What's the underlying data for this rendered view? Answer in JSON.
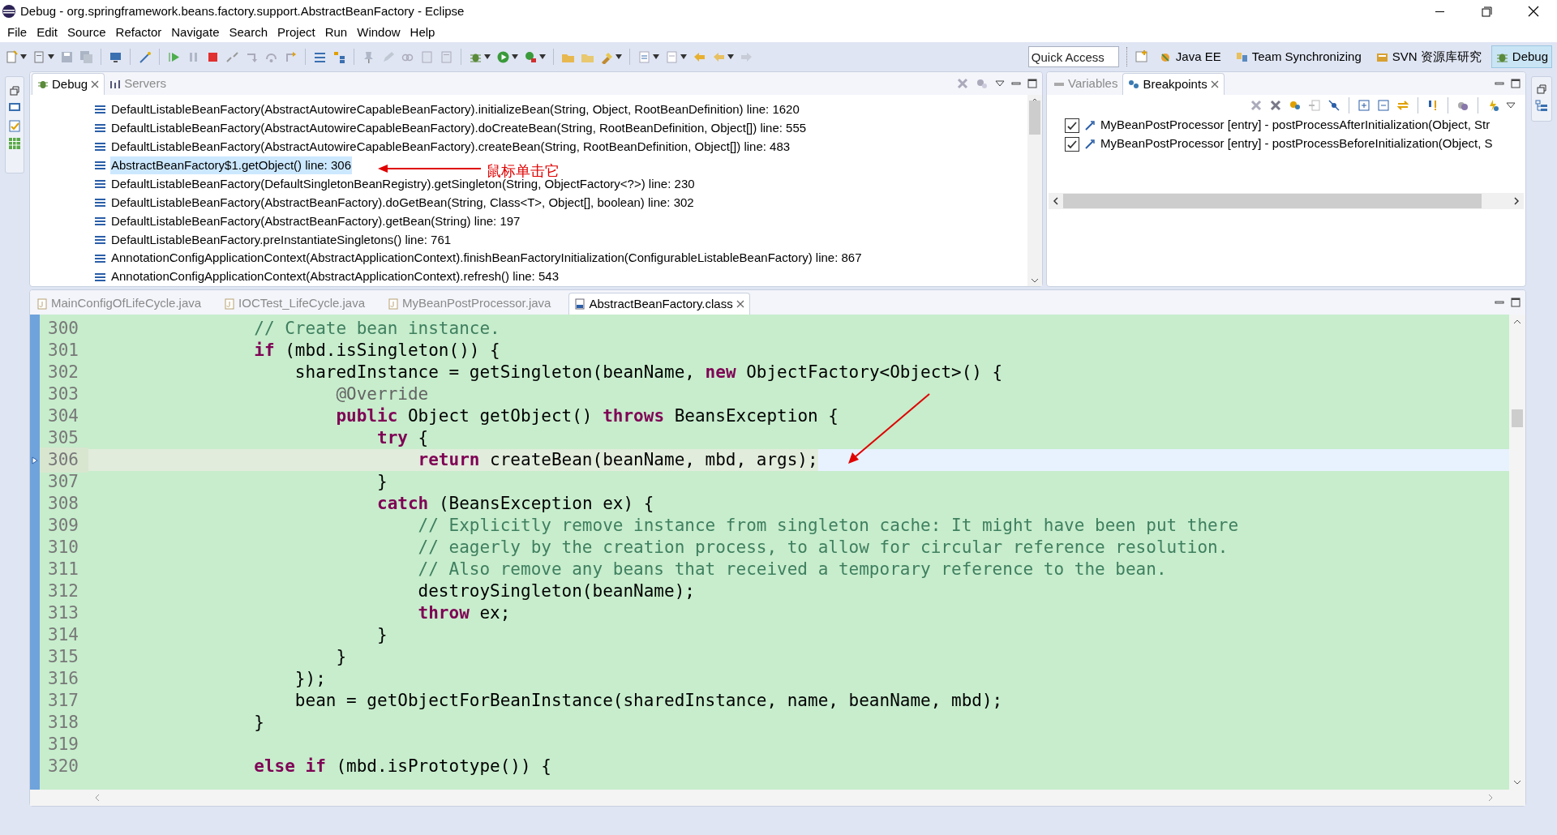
{
  "window": {
    "title": "Debug - org.springframework.beans.factory.support.AbstractBeanFactory - Eclipse"
  },
  "menu": [
    "File",
    "Edit",
    "Source",
    "Refactor",
    "Navigate",
    "Search",
    "Project",
    "Run",
    "Window",
    "Help"
  ],
  "quick_access": {
    "placeholder": "Quick Access"
  },
  "perspectives": [
    {
      "label": "Java EE",
      "selected": false
    },
    {
      "label": "Team Synchronizing",
      "selected": false
    },
    {
      "label": "SVN 资源库研究",
      "selected": false
    },
    {
      "label": "Debug",
      "selected": true
    }
  ],
  "debug_view": {
    "tabs": [
      {
        "label": "Debug",
        "selected": true
      },
      {
        "label": "Servers",
        "selected": false
      }
    ],
    "frames": [
      {
        "text": "DefaultListableBeanFactory(AbstractAutowireCapableBeanFactory).initializeBean(String, Object, RootBeanDefinition) line: 1620",
        "selected": false
      },
      {
        "text": "DefaultListableBeanFactory(AbstractAutowireCapableBeanFactory).doCreateBean(String, RootBeanDefinition, Object[]) line: 555",
        "selected": false
      },
      {
        "text": "DefaultListableBeanFactory(AbstractAutowireCapableBeanFactory).createBean(String, RootBeanDefinition, Object[]) line: 483",
        "selected": false
      },
      {
        "text": "AbstractBeanFactory$1.getObject() line: 306",
        "selected": true
      },
      {
        "text": "DefaultListableBeanFactory(DefaultSingletonBeanRegistry).getSingleton(String, ObjectFactory<?>) line: 230",
        "selected": false
      },
      {
        "text": "DefaultListableBeanFactory(AbstractBeanFactory).doGetBean(String, Class<T>, Object[], boolean) line: 302",
        "selected": false
      },
      {
        "text": "DefaultListableBeanFactory(AbstractBeanFactory).getBean(String) line: 197",
        "selected": false
      },
      {
        "text": "DefaultListableBeanFactory.preInstantiateSingletons() line: 761",
        "selected": false
      },
      {
        "text": "AnnotationConfigApplicationContext(AbstractApplicationContext).finishBeanFactoryInitialization(ConfigurableListableBeanFactory) line: 867",
        "selected": false
      },
      {
        "text": "AnnotationConfigApplicationContext(AbstractApplicationContext).refresh() line: 543",
        "selected": false
      }
    ],
    "note": "鼠标单击它"
  },
  "side_view": {
    "tabs": [
      {
        "label": "Variables",
        "selected": false
      },
      {
        "label": "Breakpoints",
        "selected": true
      }
    ],
    "breakpoints": [
      {
        "label": "MyBeanPostProcessor [entry] - postProcessAfterInitialization(Object, Str",
        "checked": true
      },
      {
        "label": "MyBeanPostProcessor [entry] - postProcessBeforeInitialization(Object, S",
        "checked": true
      }
    ]
  },
  "editor": {
    "tabs": [
      {
        "label": "MainConfigOfLifeCycle.java",
        "selected": false
      },
      {
        "label": "IOCTest_LifeCycle.java",
        "selected": false
      },
      {
        "label": "MyBeanPostProcessor.java",
        "selected": false
      },
      {
        "label": "AbstractBeanFactory.class",
        "selected": true
      }
    ],
    "lines": [
      {
        "number": "300",
        "current": false,
        "segments": [
          {
            "kind": "comment",
            "text": "                // Create bean instance."
          }
        ]
      },
      {
        "number": "301",
        "current": false,
        "segments": [
          {
            "kind": "keyword",
            "text": "                if"
          },
          {
            "kind": "plain",
            "text": " (mbd.isSingleton()) {"
          }
        ]
      },
      {
        "number": "302",
        "current": false,
        "segments": [
          {
            "kind": "plain",
            "text": "                    sharedInstance = getSingleton(beanName, "
          },
          {
            "kind": "keyword",
            "text": "new"
          },
          {
            "kind": "plain",
            "text": " ObjectFactory<Object>() {"
          }
        ]
      },
      {
        "number": "303",
        "current": false,
        "segments": [
          {
            "kind": "annotation",
            "text": "                        @Override"
          }
        ]
      },
      {
        "number": "304",
        "current": false,
        "segments": [
          {
            "kind": "keyword",
            "text": "                        public"
          },
          {
            "kind": "plain",
            "text": " Object getObject() "
          },
          {
            "kind": "keyword",
            "text": "throws"
          },
          {
            "kind": "plain",
            "text": " BeansException {"
          }
        ]
      },
      {
        "number": "305",
        "current": false,
        "segments": [
          {
            "kind": "keyword",
            "text": "                            try"
          },
          {
            "kind": "plain",
            "text": " {"
          }
        ]
      },
      {
        "number": "306",
        "current": true,
        "segments": [
          {
            "kind": "keyword",
            "text": "                                return"
          },
          {
            "kind": "plain",
            "text": " createBean(beanName, mbd, args);"
          }
        ]
      },
      {
        "number": "307",
        "current": false,
        "segments": [
          {
            "kind": "plain",
            "text": "                            }"
          }
        ]
      },
      {
        "number": "308",
        "current": false,
        "segments": [
          {
            "kind": "keyword",
            "text": "                            catch"
          },
          {
            "kind": "plain",
            "text": " (BeansException ex) {"
          }
        ]
      },
      {
        "number": "309",
        "current": false,
        "segments": [
          {
            "kind": "comment",
            "text": "                                // Explicitly remove instance from singleton cache: It might have been put there"
          }
        ]
      },
      {
        "number": "310",
        "current": false,
        "segments": [
          {
            "kind": "comment",
            "text": "                                // eagerly by the creation process, to allow for circular reference resolution."
          }
        ]
      },
      {
        "number": "311",
        "current": false,
        "segments": [
          {
            "kind": "comment",
            "text": "                                // Also remove any beans that received a temporary reference to the bean."
          }
        ]
      },
      {
        "number": "312",
        "current": false,
        "segments": [
          {
            "kind": "plain",
            "text": "                                destroySingleton(beanName);"
          }
        ]
      },
      {
        "number": "313",
        "current": false,
        "segments": [
          {
            "kind": "keyword",
            "text": "                                throw"
          },
          {
            "kind": "plain",
            "text": " ex;"
          }
        ]
      },
      {
        "number": "314",
        "current": false,
        "segments": [
          {
            "kind": "plain",
            "text": "                            }"
          }
        ]
      },
      {
        "number": "315",
        "current": false,
        "segments": [
          {
            "kind": "plain",
            "text": "                        }"
          }
        ]
      },
      {
        "number": "316",
        "current": false,
        "segments": [
          {
            "kind": "plain",
            "text": "                    });"
          }
        ]
      },
      {
        "number": "317",
        "current": false,
        "segments": [
          {
            "kind": "plain",
            "text": "                    bean = getObjectForBeanInstance(sharedInstance, name, beanName, mbd);"
          }
        ]
      },
      {
        "number": "318",
        "current": false,
        "segments": [
          {
            "kind": "plain",
            "text": "                }"
          }
        ]
      },
      {
        "number": "319",
        "current": false
      },
      {
        "number": "320",
        "current": false,
        "segments": [
          {
            "kind": "keyword",
            "text": "                else if"
          },
          {
            "kind": "plain",
            "text": " (mbd.isPrototype()) {"
          }
        ]
      }
    ]
  }
}
